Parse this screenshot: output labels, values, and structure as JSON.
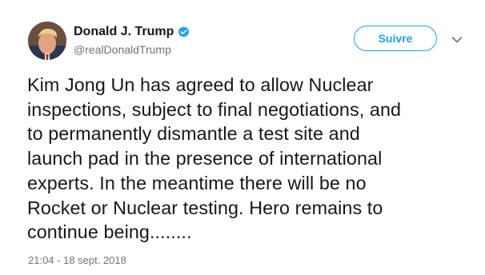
{
  "tweet": {
    "author": {
      "display_name": "Donald J. Trump",
      "handle": "@realDonaldTrump",
      "verified": true,
      "verified_icon": "verified-badge-icon",
      "avatar_icon": "profile-avatar"
    },
    "follow_label": "Suivre",
    "menu_icon": "chevron-down-icon",
    "text_lines": [
      "Kim Jong Un has agreed to allow Nuclear",
      "inspections, subject to final negotiations, and",
      "to permanently dismantle a test site and",
      "launch pad in the presence of international",
      "experts. In the meantime there will be no",
      "Rocket or Nuclear testing. Hero remains to",
      "continue being........"
    ],
    "timestamp": "21:04 - 18 sept. 2018"
  },
  "colors": {
    "accent": "#1da1f2",
    "text": "#14171a",
    "secondary_text": "#657786"
  }
}
